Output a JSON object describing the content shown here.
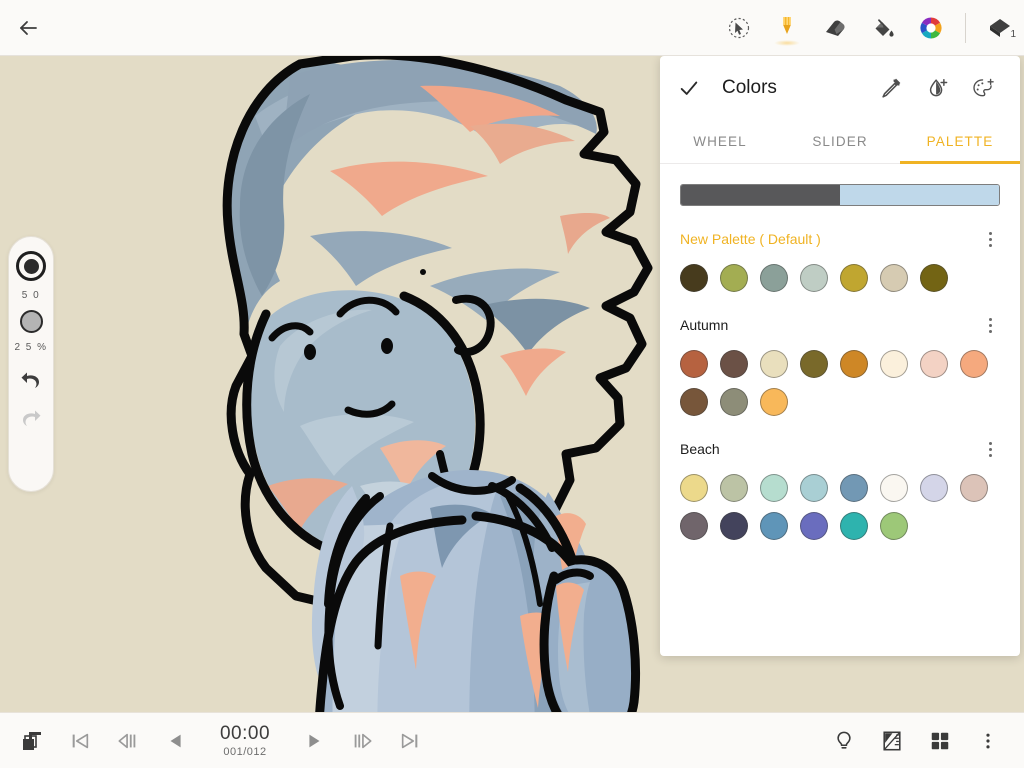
{
  "app": {
    "canvas_background": "#e3dcc6",
    "accent": "#f0b323"
  },
  "topbar": {
    "back_label": "",
    "tools": [
      {
        "name": "selection-tool",
        "label": "Select",
        "active": false
      },
      {
        "name": "brush-tool",
        "label": "Brush",
        "active": true
      },
      {
        "name": "eraser-tool",
        "label": "Eraser",
        "active": false
      },
      {
        "name": "fill-tool",
        "label": "Fill",
        "active": false
      },
      {
        "name": "color-wheel-tool",
        "label": "Color",
        "active": false
      }
    ],
    "layers_badge": "1",
    "layers_label": "Layers"
  },
  "brush_panel": {
    "size_value": "5 0",
    "opacity_value": "2 5 %",
    "undo_label": "Undo",
    "redo_label": "Redo"
  },
  "colors_panel": {
    "title": "Colors",
    "confirm_label": "",
    "header_icons": [
      {
        "name": "eyedropper-icon",
        "label": "Pick color"
      },
      {
        "name": "add-color-icon",
        "label": "Add color"
      },
      {
        "name": "add-palette-icon",
        "label": "Add palette"
      }
    ],
    "tabs": [
      {
        "label": "WHEEL",
        "active": false
      },
      {
        "label": "SLIDER",
        "active": false
      },
      {
        "label": "PALETTE",
        "active": true
      }
    ],
    "color_bar": {
      "current_color": "#58585a",
      "previous_color": "#bfd8ea",
      "split_percent": 50
    },
    "palettes": [
      {
        "name": "New Palette ( Default )",
        "is_default": true,
        "rows": [
          [
            "#473b1d",
            "#a3ad52",
            "#8ba099",
            "#bfcdc4",
            "#c0a630",
            "#d6cbb2",
            "#736414"
          ]
        ]
      },
      {
        "name": "Autumn",
        "is_default": false,
        "rows": [
          [
            "#b66240",
            "#6b5146",
            "#e9dfbd",
            "#79692a",
            "#ce8726",
            "#fbf0dc",
            "#f3d2c4",
            "#f5a97e"
          ],
          [
            "#77563a",
            "#8d8d78",
            "#f8b85a"
          ]
        ]
      },
      {
        "name": "Beach",
        "is_default": false,
        "rows": [
          [
            "#ecd98b",
            "#bcc3a5",
            "#b6ddcf",
            "#a9cfd4",
            "#7298b4",
            "#faf7f1",
            "#d4d5e8",
            "#dcc3b8"
          ],
          [
            "#70656b",
            "#43435c",
            "#5f95b8",
            "#6a6dbe",
            "#2eb3ae",
            "#9dc878"
          ]
        ]
      }
    ]
  },
  "bottombar": {
    "timecode": "00:00",
    "frame_counter": "001/012",
    "left_controls": [
      {
        "name": "frames-stack-button",
        "label": "Frames"
      },
      {
        "name": "skip-to-start-button",
        "label": "First frame"
      },
      {
        "name": "step-back-frames-button",
        "label": "Previous frames"
      },
      {
        "name": "previous-frame-button",
        "label": "Previous frame"
      }
    ],
    "right_controls": [
      {
        "name": "play-button",
        "label": "Play"
      },
      {
        "name": "step-forward-frames-button",
        "label": "Next frames"
      },
      {
        "name": "skip-to-end-button",
        "label": "Last frame"
      }
    ],
    "tools": [
      {
        "name": "onion-skin-button",
        "label": "Onion skin"
      },
      {
        "name": "ruler-button",
        "label": "Tools"
      },
      {
        "name": "grid-view-button",
        "label": "Grid"
      },
      {
        "name": "overflow-menu-button",
        "label": "More"
      }
    ]
  }
}
